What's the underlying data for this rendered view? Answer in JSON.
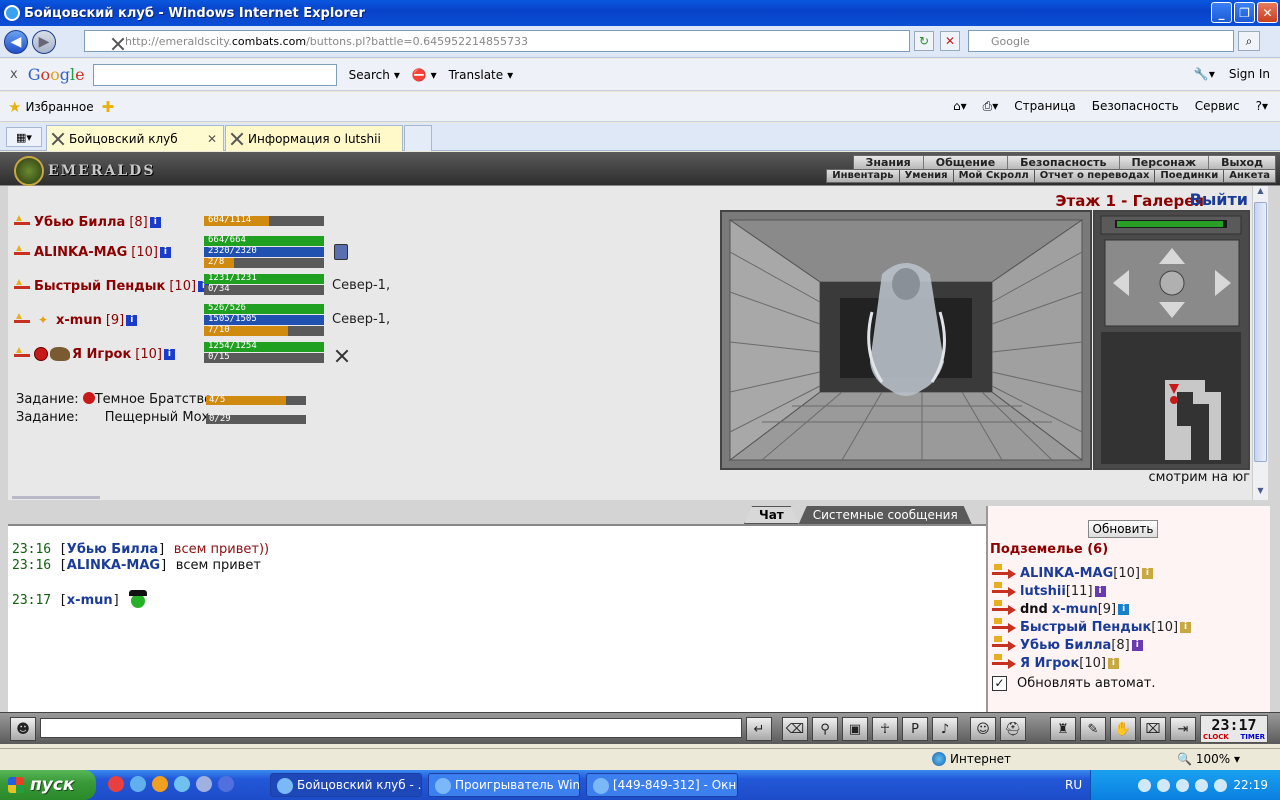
{
  "window": {
    "title": "Бойцовский клуб - Windows Internet Explorer",
    "min": "_",
    "max": "❐",
    "close": "✕"
  },
  "address": {
    "url_prefix": "http://emeraldscity.",
    "url_domain": "combats.com",
    "url_suffix": "/buttons.pl?battle=0.645952214855733",
    "search_placeholder": "Google"
  },
  "google_bar": {
    "close": "x",
    "search_label": "Search",
    "translate_label": "Translate",
    "sign_in": "Sign In"
  },
  "favorites": {
    "label": "Избранное",
    "tools": [
      "Страница",
      "Безопасность",
      "Сервис"
    ]
  },
  "tabs": [
    {
      "label": "Бойцовский клуб"
    },
    {
      "label": "Информация о lutshii"
    }
  ],
  "game": {
    "logo_text": "EMERALDS",
    "top_menu": [
      "Знания",
      "Общение",
      "Безопасность",
      "Персонаж",
      "Выход"
    ],
    "sub_menu": [
      "Инвентарь",
      "Умения",
      "Мой Скролл",
      "Отчет о переводах",
      "Поединки",
      "Анкета"
    ],
    "floor_title": "Этаж 1 - Галерея",
    "exit_label": "Выйти",
    "look_direction": "смотрим на юг",
    "players": [
      {
        "name": "Убью Билла",
        "level": "[8]",
        "bars": [
          {
            "text": "604/1114",
            "fill": 0.54,
            "kind": "hpo"
          }
        ]
      },
      {
        "name": "ALINKA-MAG",
        "level": "[10]",
        "bars": [
          {
            "text": "664/664",
            "fill": 1.0,
            "kind": "hp"
          },
          {
            "text": "2320/2320",
            "fill": 1.0,
            "kind": "mana"
          },
          {
            "text": "2/8",
            "fill": 0.25,
            "kind": "prog"
          }
        ]
      },
      {
        "name": "Быстрый Пендык",
        "level": "[10]",
        "bars": [
          {
            "text": "1231/1231",
            "fill": 1.0,
            "kind": "hp"
          },
          {
            "text": "0/34",
            "fill": 0.0,
            "kind": "prog"
          }
        ],
        "position": "Север-1,"
      },
      {
        "name": "x-mun",
        "level": "[9]",
        "bars": [
          {
            "text": "526/526",
            "fill": 1.0,
            "kind": "hp"
          },
          {
            "text": "1505/1505",
            "fill": 1.0,
            "kind": "mana"
          },
          {
            "text": "7/10",
            "fill": 0.7,
            "kind": "prog"
          }
        ],
        "position": "Север-1,"
      },
      {
        "name": "Я Игрок",
        "level": "[10]",
        "bars": [
          {
            "text": "1254/1254",
            "fill": 1.0,
            "kind": "hp"
          },
          {
            "text": "0/15",
            "fill": 0.0,
            "kind": "prog"
          }
        ]
      }
    ],
    "tasks": [
      {
        "label": "Задание:",
        "name": "Темное Братство",
        "progress": "4/5",
        "fill": 0.8
      },
      {
        "label": "Задание:",
        "name": "Пещерный Мох",
        "progress": "0/29",
        "fill": 0.0
      }
    ],
    "chat_tabs": [
      "Чат",
      "Системные сообщения"
    ],
    "chat": [
      {
        "time": "23:16",
        "nick": "Убью Билла",
        "msg": "всем привет))",
        "style": "red"
      },
      {
        "time": "23:16",
        "nick": "ALINKA-MAG",
        "msg": "всем привет",
        "style": "black"
      },
      {
        "time": "23:17",
        "nick": "x-mun",
        "msg": "",
        "style": "black"
      }
    ],
    "online": {
      "refresh": "Обновить",
      "title": "Подземелье (6)",
      "users": [
        {
          "name": "ALINKA-MAG",
          "level": "[10]"
        },
        {
          "name": "lutshii",
          "level": "[11]"
        },
        {
          "prefix": "dnd",
          "name": "x-mun",
          "level": "[9]"
        },
        {
          "name": "Быстрый Пендык",
          "level": "[10]"
        },
        {
          "name": "Убью Билла",
          "level": "[8]"
        },
        {
          "name": "Я Игрок",
          "level": "[10]"
        }
      ],
      "auto_refresh": "Обновлять автомат."
    },
    "clock": {
      "time": "23:17",
      "sub1": "CLOCK",
      "sub2": "TIMER"
    }
  },
  "status": {
    "zone": "Интернет",
    "zoom": "100%"
  },
  "taskbar": {
    "start": "пуск",
    "items": [
      "Бойцовский клуб - ...",
      "Проигрыватель Win...",
      "[449-849-312] - Окн..."
    ],
    "lang": "RU",
    "time": "22:19"
  }
}
